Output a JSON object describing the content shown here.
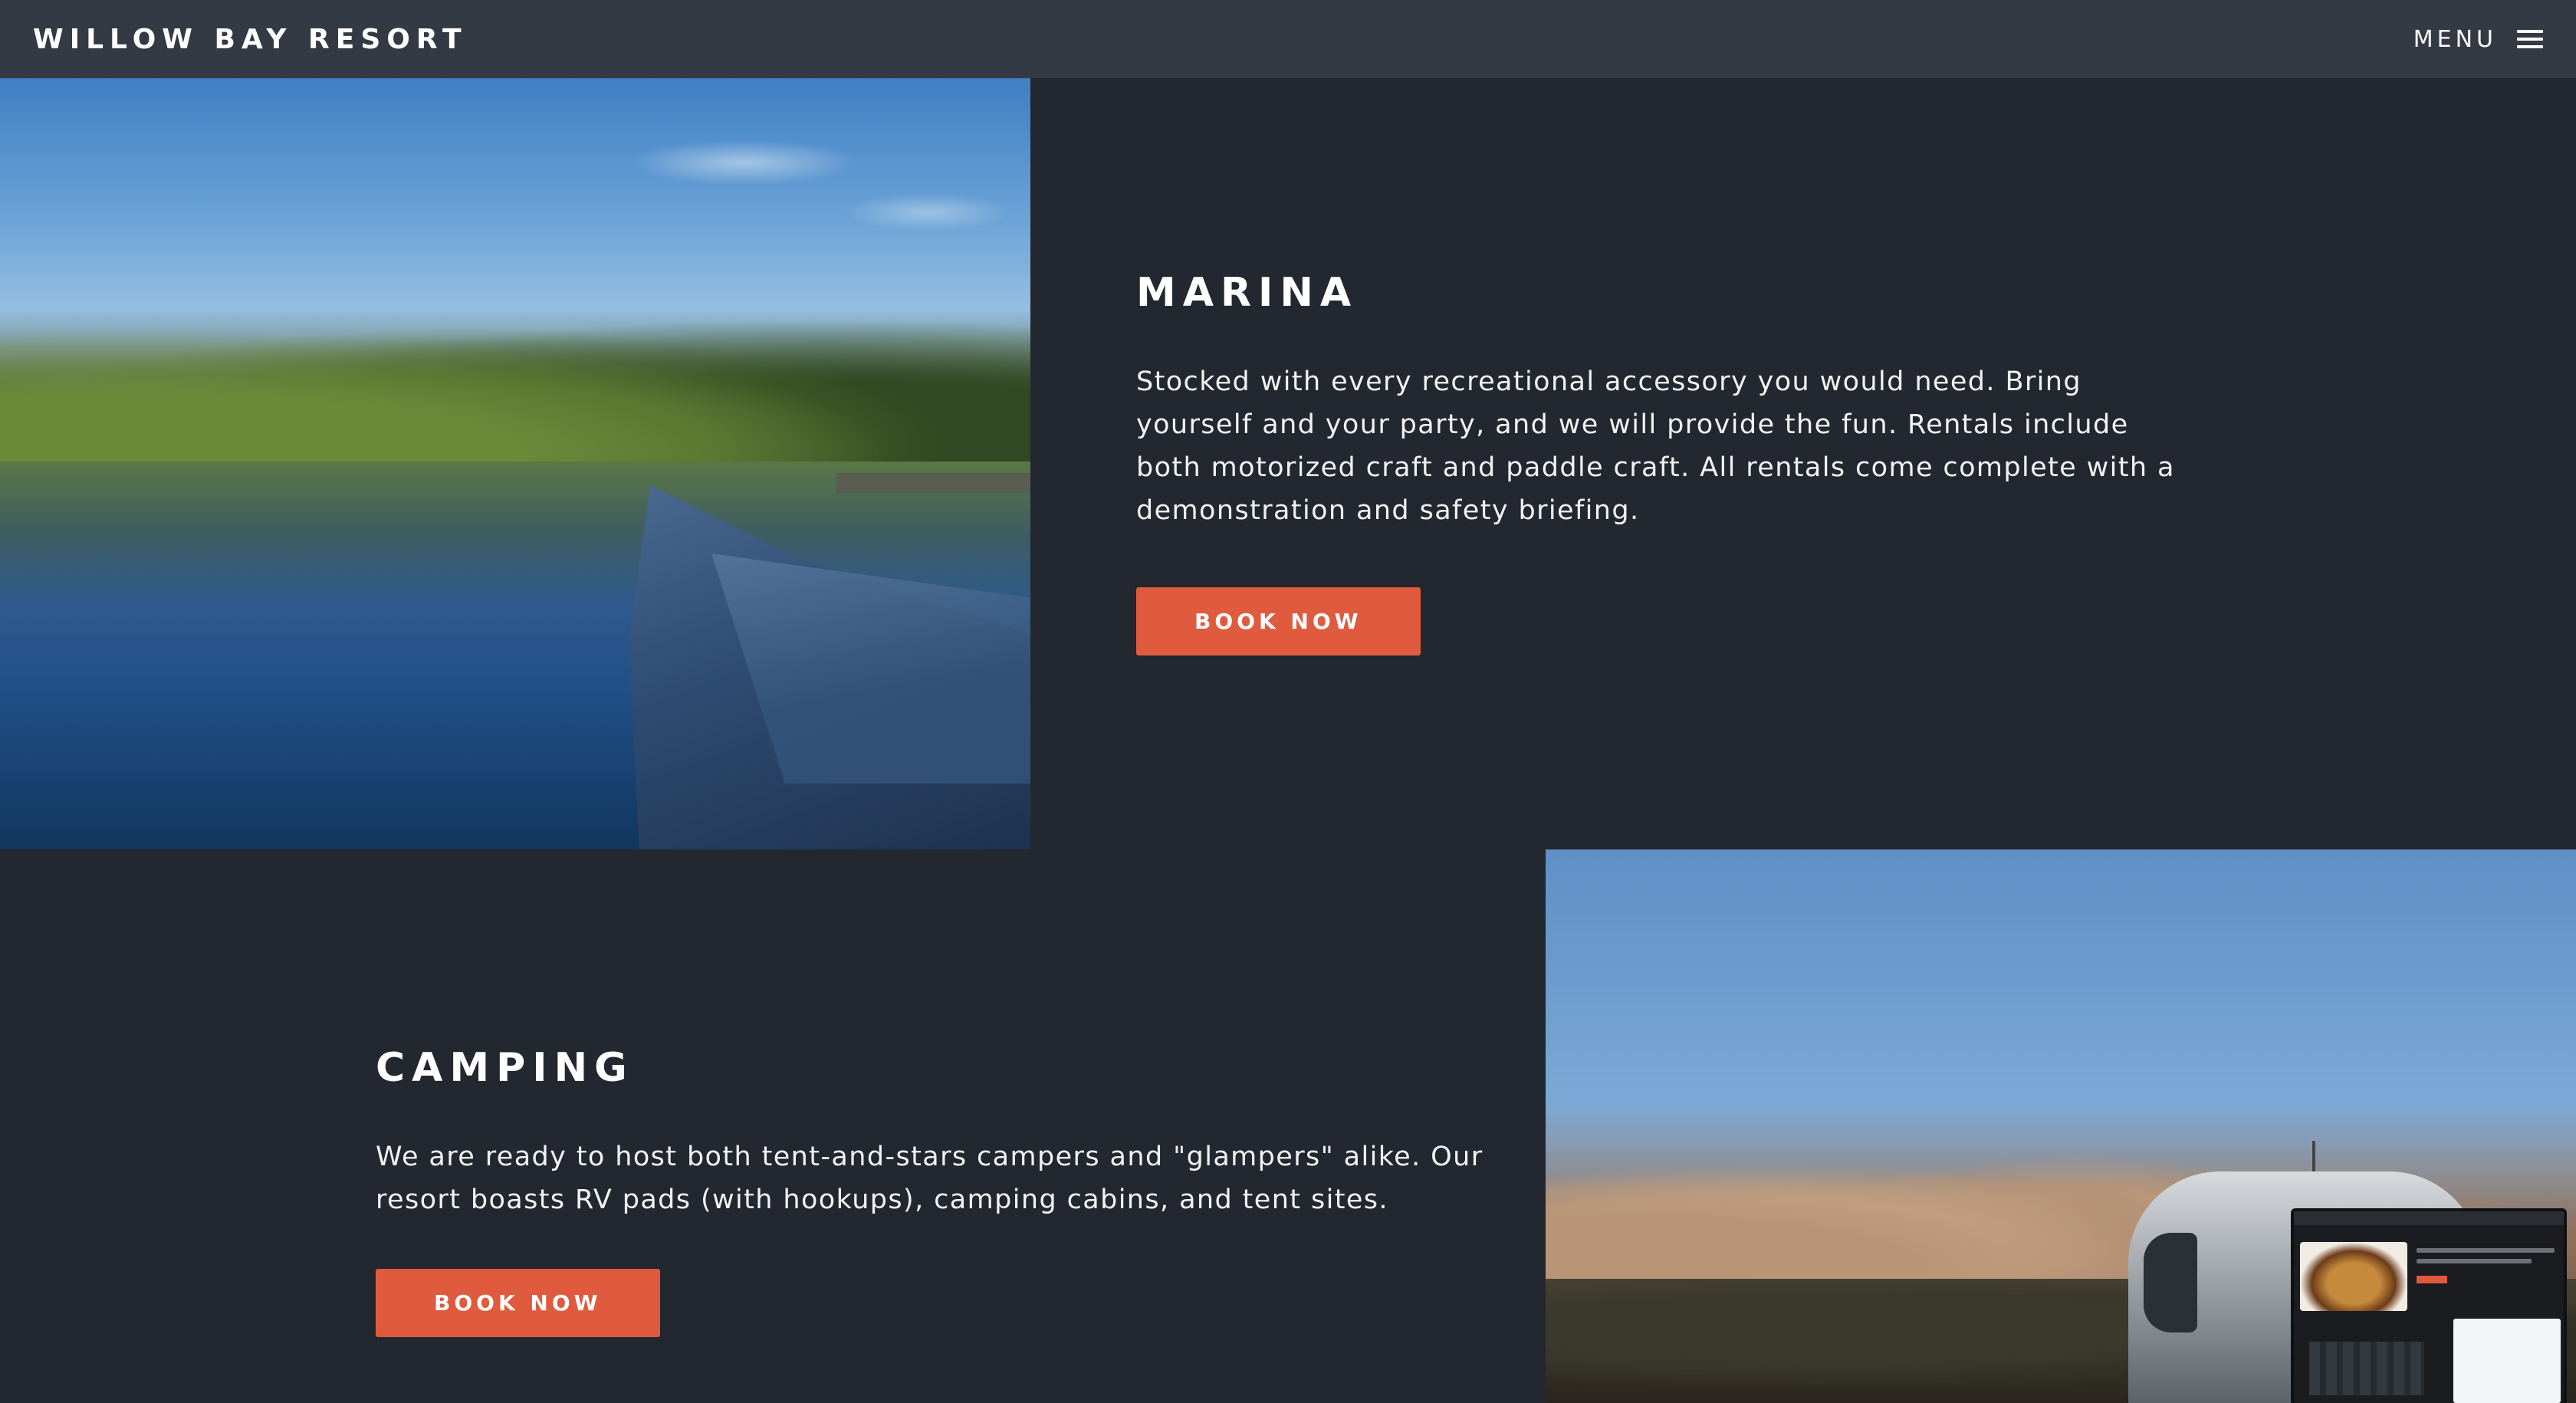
{
  "header": {
    "brand": "WILLOW BAY RESORT",
    "menu_label": "MENU",
    "menu_icon": "hamburger-icon"
  },
  "sections": [
    {
      "id": "marina",
      "title": "MARINA",
      "description": "Stocked with every recreational accessory you would need. Bring yourself and your party, and we will provide the fun. Rentals include both motorized craft and paddle craft. All rentals come complete with a demonstration and safety briefing.",
      "button_label": "BOOK NOW",
      "image_subject": "canoe on a calm lake"
    },
    {
      "id": "camping",
      "title": "CAMPING",
      "description": "We are ready to host both tent-and-stars campers and \"glampers\" alike. Our resort boasts RV pads (with hookups), camping cabins, and tent sites.",
      "button_label": "BOOK NOW",
      "image_subject": "airstream trailer among desert boulders"
    }
  ],
  "colors": {
    "header_bg": "#343a44",
    "page_bg": "#23272f",
    "accent": "#e05a3e",
    "text": "#ffffff"
  }
}
